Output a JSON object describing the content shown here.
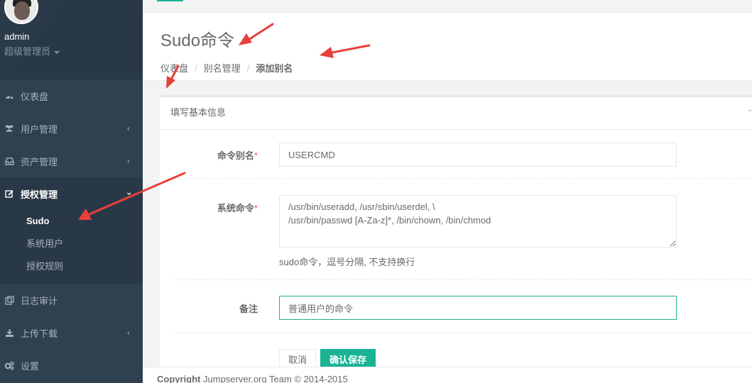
{
  "profile": {
    "username": "admin",
    "role": "超级管理员"
  },
  "sidebar": {
    "items": [
      {
        "label": "仪表盘",
        "icon": "dashboard-icon"
      },
      {
        "label": "用户管理",
        "icon": "users-icon"
      },
      {
        "label": "资产管理",
        "icon": "inbox-icon"
      },
      {
        "label": "授权管理",
        "icon": "edit-icon"
      },
      {
        "label": "日志审计",
        "icon": "copy-icon"
      },
      {
        "label": "上传下载",
        "icon": "download-icon"
      },
      {
        "label": "设置",
        "icon": "gears-icon"
      }
    ],
    "submenu": [
      {
        "label": "Sudo"
      },
      {
        "label": "系统用户"
      },
      {
        "label": "授权规则"
      }
    ]
  },
  "page": {
    "title": "Sudo命令",
    "breadcrumb": [
      "仪表盘",
      "别名管理",
      "添加别名"
    ]
  },
  "form": {
    "box_title": "填写基本信息",
    "alias_label": "命令别名",
    "alias_value": "USERCMD",
    "cmd_label": "系统命令",
    "cmd_value": "/usr/bin/useradd, /usr/sbin/userdel, \\\n/usr/bin/passwd [A-Za-z]*, /bin/chown, /bin/chmod",
    "cmd_help": "sudo命令，逗号分隔, 不支持换行",
    "note_label": "备注",
    "note_value": "普通用户的命令",
    "required_mark": "*",
    "cancel_label": "取消",
    "save_label": "确认保存"
  },
  "footer": {
    "brand": "Copyright",
    "text": "Jumpserver.org Team © 2014-2015"
  },
  "colors": {
    "sidebar": "#2f4050",
    "accent": "#1ab394",
    "arrow": "#e8403a",
    "required": "#ed5565"
  }
}
